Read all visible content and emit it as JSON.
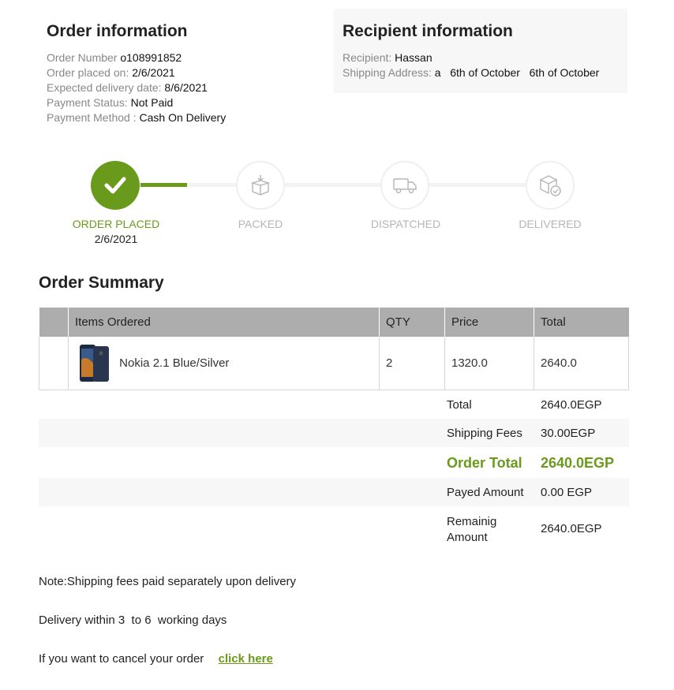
{
  "order_info": {
    "title": "Order information",
    "order_number_label": "Order Number",
    "order_number": "o108991852",
    "placed_label": "Order placed on:",
    "placed": "2/6/2021",
    "expected_label": "Expected delivery date:",
    "expected": "8/6/2021",
    "payment_status_label": "Payment Status:",
    "payment_status": "Not Paid",
    "payment_method_label": "Payment Method :",
    "payment_method": "Cash On Delivery"
  },
  "recipient_info": {
    "title": "Recipient information",
    "recipient_label": "Recipient:",
    "recipient": "Hassan",
    "address_label": "Shipping Address:",
    "address": "a   6th of October   6th of October"
  },
  "steps": [
    {
      "label": "ORDER PLACED",
      "date": "2/6/2021",
      "icon": "check-icon",
      "active": true
    },
    {
      "label": "PACKED",
      "icon": "box-icon",
      "active": false
    },
    {
      "label": "DISPATCHED",
      "icon": "truck-icon",
      "active": false
    },
    {
      "label": "DELIVERED",
      "icon": "package-check-icon",
      "active": false
    }
  ],
  "summary": {
    "title": "Order Summary",
    "columns": [
      "",
      "Items Ordered",
      "QTY",
      "Price",
      "Total"
    ],
    "items": [
      {
        "name": "Nokia 2.1 Blue/Silver",
        "qty": "2",
        "price": "1320.0",
        "total": "2640.0"
      }
    ],
    "totals": [
      {
        "label": "Total",
        "value": "2640.0EGP"
      },
      {
        "label": "Shipping Fees",
        "value": "30.00EGP"
      },
      {
        "label": "Order Total",
        "value": "2640.0EGP"
      },
      {
        "label": "Payed Amount",
        "value": "0.00 EGP"
      },
      {
        "label": "Remainig Amount",
        "value": "2640.0EGP"
      }
    ]
  },
  "notes": {
    "shipping": "Note:Shipping fees paid separately upon delivery",
    "delivery": "Delivery within 3  to 6  working days",
    "cancel": "If you want to cancel your order",
    "cancel_link": "click here"
  },
  "colors": {
    "accent": "#6a9a1b",
    "header_bg": "#adadad",
    "shade": "#f7f7f7"
  }
}
